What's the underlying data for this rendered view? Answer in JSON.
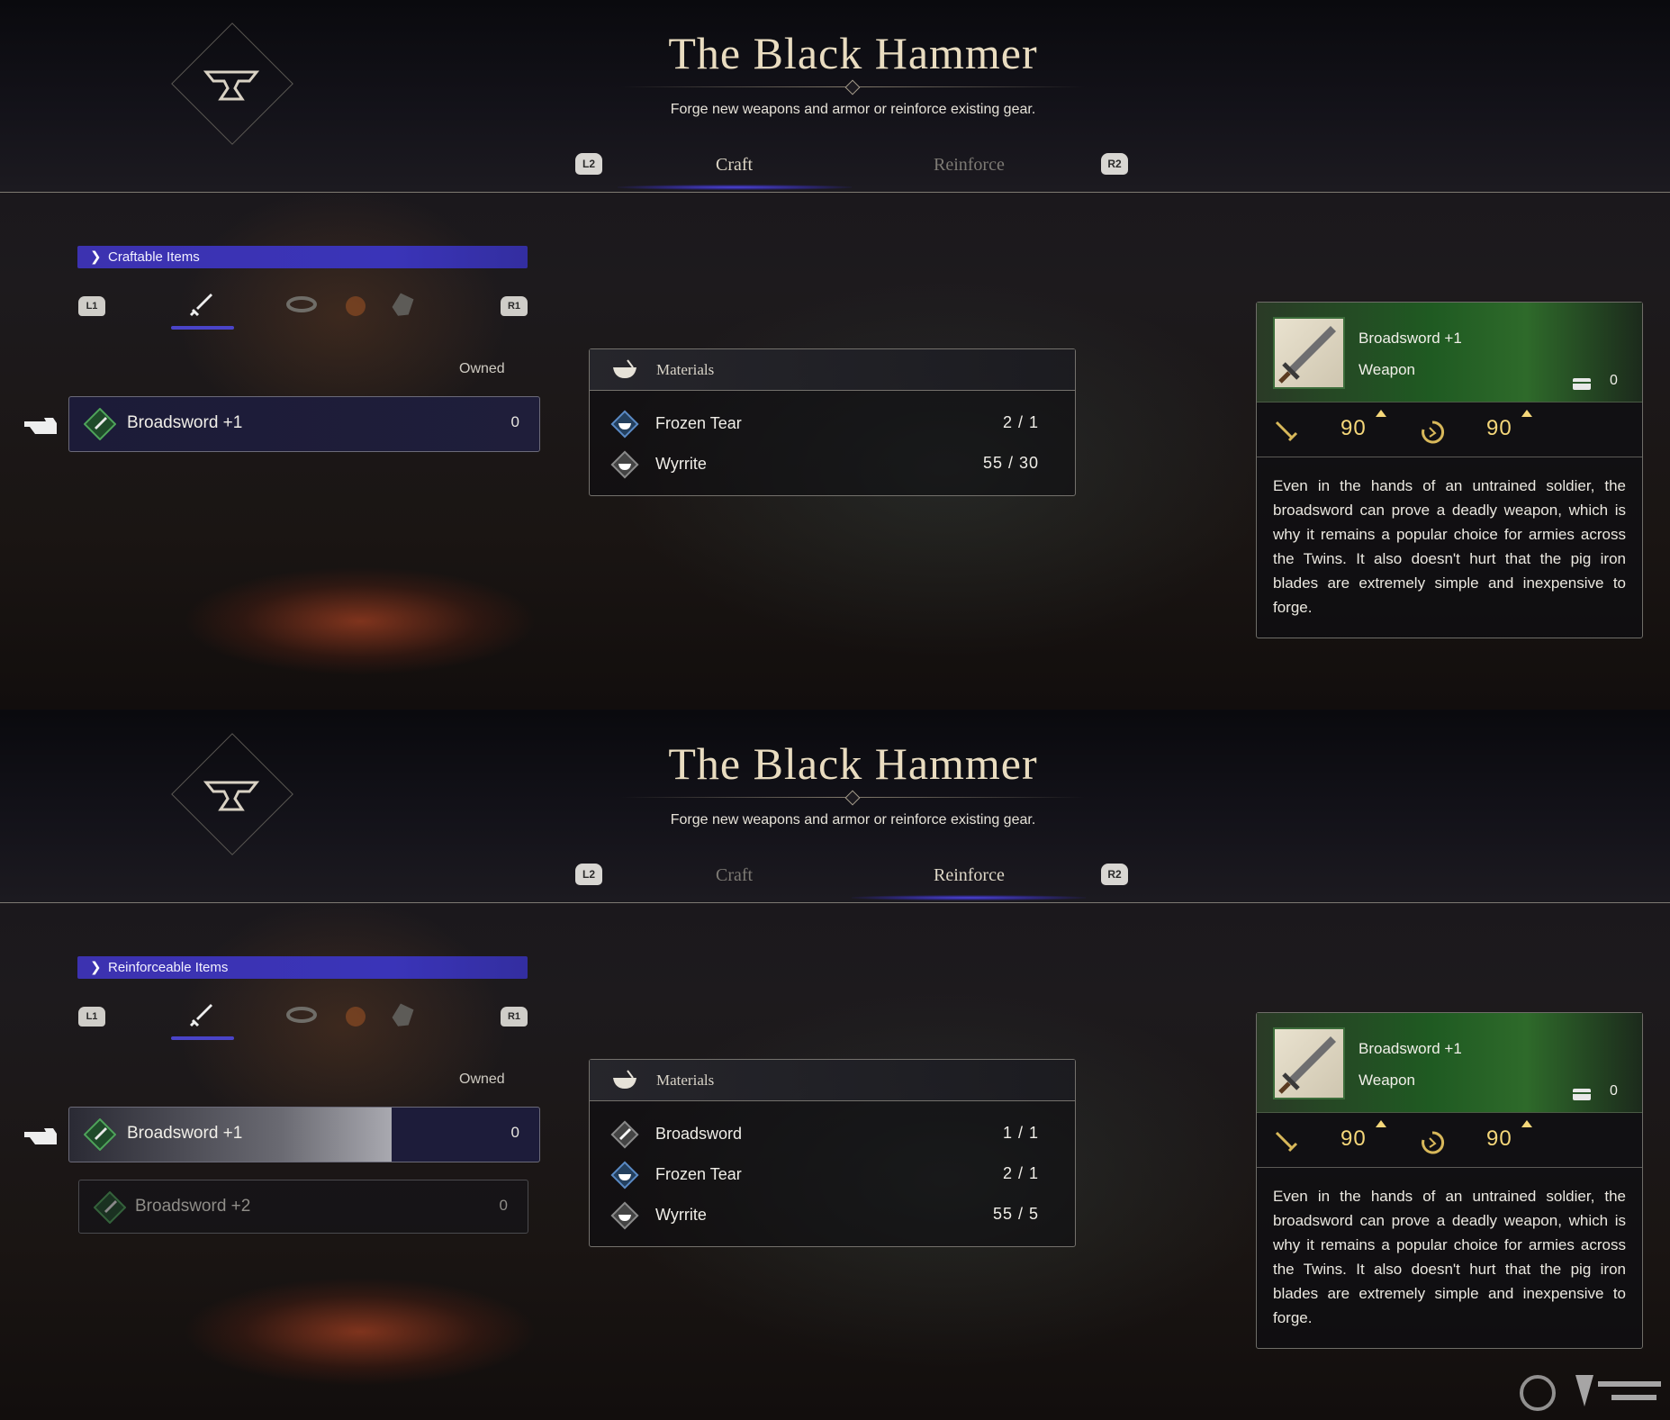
{
  "title": "The Black Hammer",
  "subtitle": "Forge new weapons and armor or reinforce existing gear.",
  "shoulder_left": "L2",
  "shoulder_right": "R2",
  "cat_shoulder_left": "L1",
  "cat_shoulder_right": "R1",
  "tabs": [
    "Craft",
    "Reinforce"
  ],
  "owned_header": "Owned",
  "materials_header": "Materials",
  "accent_color": "#3c32b0",
  "stat_color": "#f5d77a",
  "icons": {
    "emblem": "anvil-icon",
    "pointer": "pointing-hand-icon",
    "categories": [
      "sword-icon",
      "ring-icon",
      "orb-icon",
      "armor-icon"
    ],
    "materials_header": "bowl-icon",
    "chest": "chest-icon",
    "stats": [
      "attack-icon",
      "stagger-icon"
    ]
  },
  "screens": [
    {
      "active_tab": "Craft",
      "section_label": "Craftable Items",
      "items": [
        {
          "name": "Broadsword +1",
          "owned": "0",
          "selected": true
        }
      ],
      "materials": [
        {
          "name": "Frozen Tear",
          "count": "2 / 1",
          "icon": "bowl-icon"
        },
        {
          "name": "Wyrrite",
          "count": "55 / 30",
          "icon": "bowl-icon"
        }
      ],
      "details": {
        "name": "Broadsword +1",
        "type": "Weapon",
        "owned": "0",
        "stats": [
          "90",
          "90"
        ],
        "description": "Even in the hands of an untrained soldier, the broadsword can prove a deadly weapon, which is why it remains a popular choice for armies across the Twins. It also doesn't hurt that the pig iron blades are extremely simple and inexpensive to forge."
      }
    },
    {
      "active_tab": "Reinforce",
      "section_label": "Reinforceable Items",
      "items": [
        {
          "name": "Broadsword +1",
          "owned": "0",
          "selected": true,
          "progress": 0.69
        },
        {
          "name": "Broadsword +2",
          "owned": "0",
          "selected": false
        }
      ],
      "materials": [
        {
          "name": "Broadsword",
          "count": "1 / 1",
          "icon": "sword-icon"
        },
        {
          "name": "Frozen Tear",
          "count": "2 / 1",
          "icon": "bowl-icon"
        },
        {
          "name": "Wyrrite",
          "count": "55 / 5",
          "icon": "bowl-icon"
        }
      ],
      "details": {
        "name": "Broadsword +1",
        "type": "Weapon",
        "owned": "0",
        "stats": [
          "90",
          "90"
        ],
        "description": "Even in the hands of an untrained soldier, the broadsword can prove a deadly weapon, which is why it remains a popular choice for armies across the Twins. It also doesn't hurt that the pig iron blades are extremely simple and inexpensive to forge."
      }
    }
  ]
}
